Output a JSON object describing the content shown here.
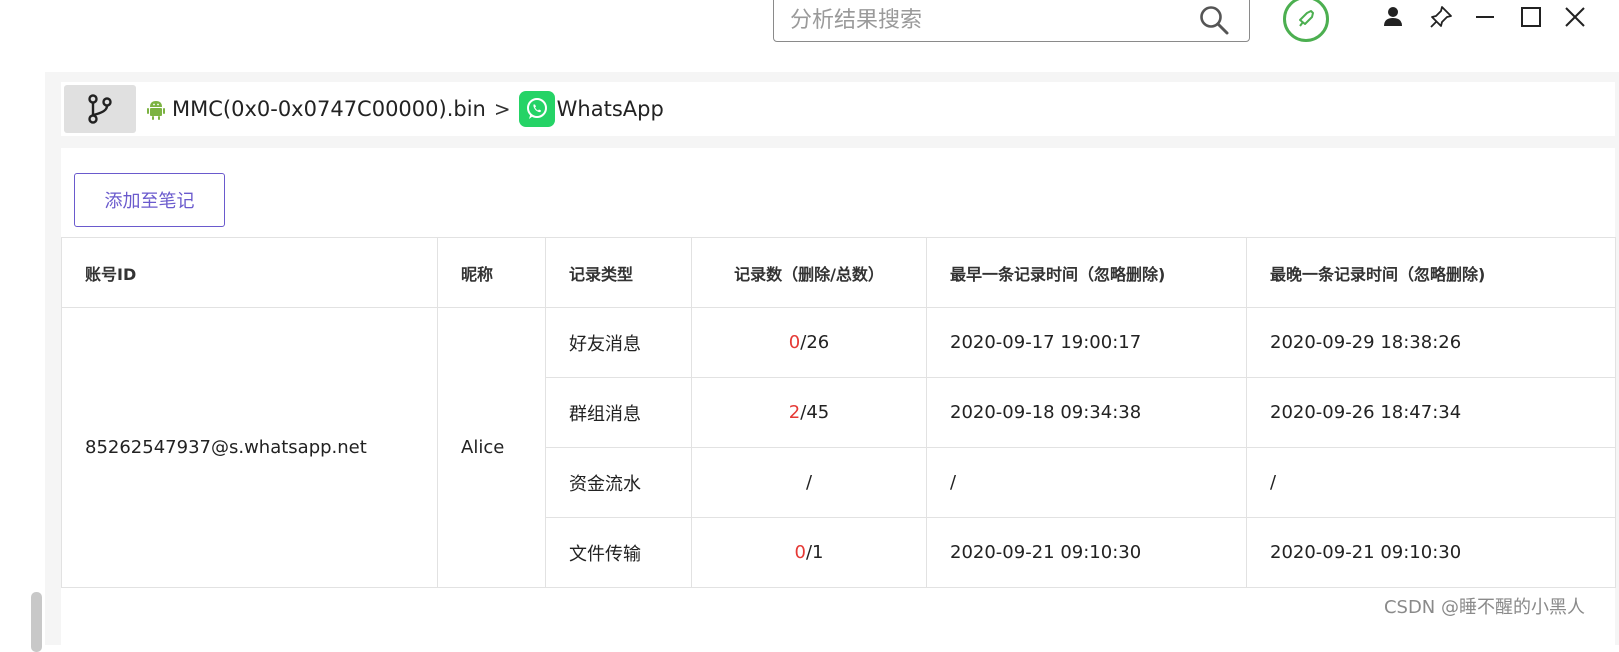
{
  "search": {
    "placeholder": "分析结果搜索"
  },
  "breadcrumb": {
    "items": [
      {
        "label": "MMC(0x0-0x0747C00000).bin",
        "icon": "android-icon"
      },
      {
        "label": "WhatsApp",
        "icon": "whatsapp-icon"
      }
    ],
    "separator": ">"
  },
  "toolbar": {
    "add_note_label": "添加至笔记"
  },
  "table": {
    "headers": [
      "账号ID",
      "昵称",
      "记录类型",
      "记录数（删除/总数）",
      "最早一条记录时间（忽略删除)",
      "最晚一条记录时间（忽略删除)"
    ],
    "account_id": "85262547937@s.whatsapp.net",
    "nickname": "Alice",
    "rows": [
      {
        "type": "好友消息",
        "deleted": "0",
        "sep": "/",
        "total": "26",
        "earliest": "2020-09-17 19:00:17",
        "latest": "2020-09-29 18:38:26"
      },
      {
        "type": "群组消息",
        "deleted": "2",
        "sep": "/",
        "total": "45",
        "earliest": "2020-09-18 09:34:38",
        "latest": "2020-09-26 18:47:34"
      },
      {
        "type": "资金流水",
        "deleted": "",
        "sep": "/",
        "total": "",
        "earliest": "/",
        "latest": "/"
      },
      {
        "type": "文件传输",
        "deleted": "0",
        "sep": "/",
        "total": "1",
        "earliest": "2020-09-21 09:10:30",
        "latest": "2020-09-21 09:10:30"
      }
    ]
  },
  "watermark": "CSDN @睡不醒的小黑人",
  "colors": {
    "accent": "#6a5acd",
    "brand_green": "#4caf50",
    "whatsapp_green": "#25d366",
    "deleted_red": "#e53935",
    "android_green": "#7cb342"
  }
}
